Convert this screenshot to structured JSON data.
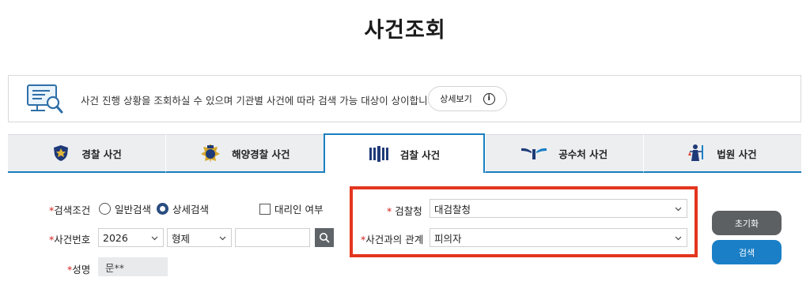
{
  "page": {
    "title": "사건조회"
  },
  "info": {
    "text": "사건 진행 상황을 조회하실 수 있으며 기관별 사건에 따라 검색 가능 대상이 상이합니다.",
    "detail_button": "상세보기",
    "detail_icon": "i"
  },
  "tabs": [
    {
      "label": "경찰 사건",
      "icon": "police-emblem-icon"
    },
    {
      "label": "해양경찰 사건",
      "icon": "coast-guard-emblem-icon"
    },
    {
      "label": "검찰 사건",
      "icon": "prosecution-emblem-icon",
      "active": true
    },
    {
      "label": "공수처 사건",
      "icon": "cio-emblem-icon"
    },
    {
      "label": "법원 사건",
      "icon": "court-emblem-icon"
    }
  ],
  "form": {
    "required_mark": "*",
    "search_condition": {
      "label": "검색조건",
      "options": [
        "일반검색",
        "상세검색"
      ],
      "selected": "상세검색",
      "proxy_label": "대리인 여부"
    },
    "case_number": {
      "label": "사건번호",
      "year": "2026",
      "type": "형제",
      "number": ""
    },
    "name": {
      "label": "성명",
      "value": "문**"
    },
    "office": {
      "label": "검찰청",
      "value": "대검찰청"
    },
    "relation": {
      "label": "사건과의 관계",
      "value": "피의자"
    },
    "reset_button": "초기화",
    "search_button": "검색"
  },
  "colors": {
    "accent": "#1a7fc0",
    "highlight": "#e4351e",
    "required": "#d0201b"
  }
}
